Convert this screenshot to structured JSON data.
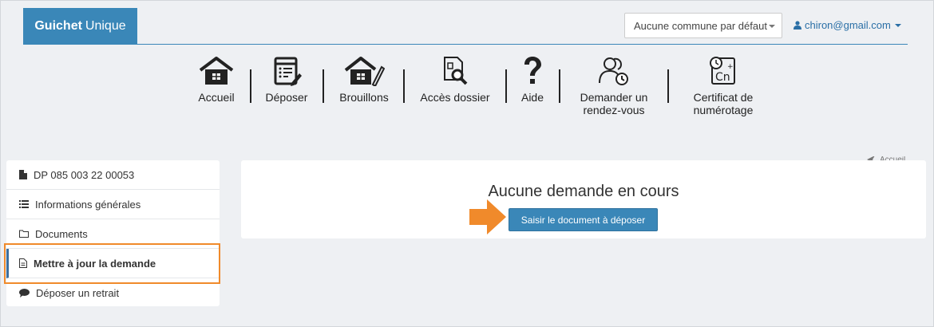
{
  "header": {
    "brand_bold": "Guichet",
    "brand_rest": "Unique",
    "commune_select": "Aucune commune par défaut",
    "user_email": "chiron@gmail.com"
  },
  "toolbar": [
    {
      "label": "Accueil",
      "icon": "house-icon"
    },
    {
      "label": "Déposer",
      "icon": "form-edit-icon"
    },
    {
      "label": "Brouillons",
      "icon": "house-pencil-icon"
    },
    {
      "label": "Accès dossier",
      "icon": "file-search-icon"
    },
    {
      "label": "Aide",
      "icon": "question-icon"
    },
    {
      "label_line1": "Demander un",
      "label_line2": "rendez-vous",
      "icon": "users-clock-icon"
    },
    {
      "label_line1": "Certificat de",
      "label_line2": "numérotage",
      "icon": "calculator-clock-icon"
    }
  ],
  "breadcrumb": {
    "label": "Accueil"
  },
  "sidebar": {
    "items": [
      {
        "label": "DP 085 003 22 00053",
        "icon": "file-icon"
      },
      {
        "label": "Informations générales",
        "icon": "list-icon"
      },
      {
        "label": "Documents",
        "icon": "folder-icon"
      },
      {
        "label": "Mettre à jour la demande",
        "icon": "document-icon",
        "active": true
      },
      {
        "label": "Déposer un retrait",
        "icon": "comment-icon"
      }
    ]
  },
  "main": {
    "title": "Aucune demande en cours",
    "button": "Saisir le document à déposer"
  },
  "colors": {
    "brand": "#3a87b8",
    "highlight": "#f08a2b",
    "link": "#2a6fa6"
  }
}
